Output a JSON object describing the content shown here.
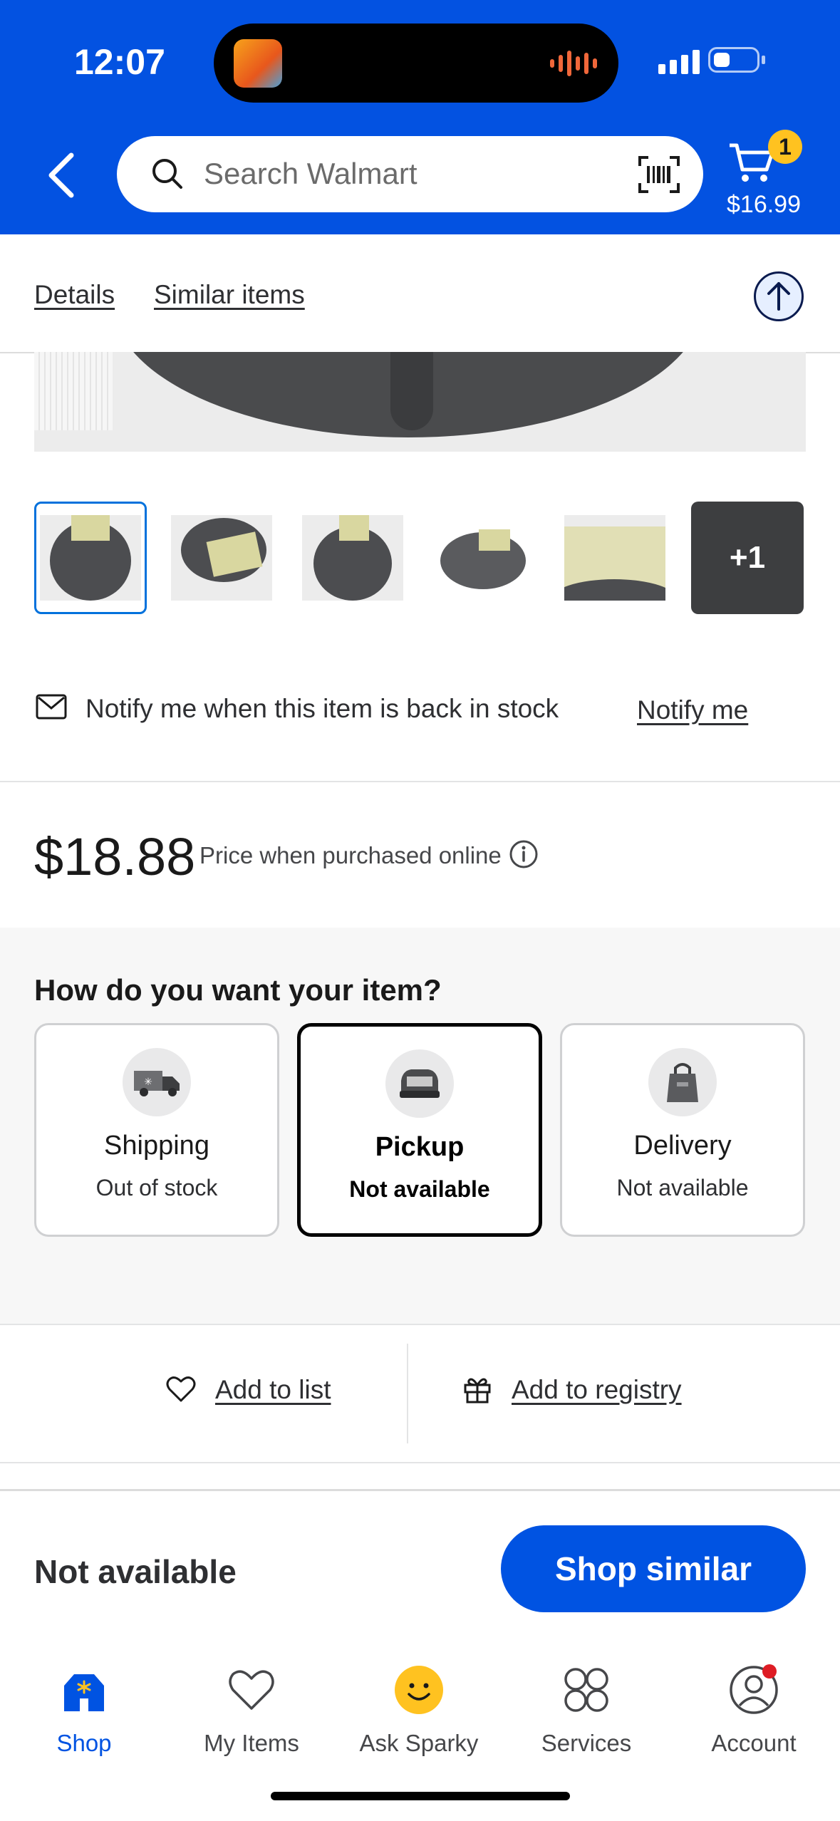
{
  "status_bar": {
    "time": "12:07"
  },
  "header": {
    "search_placeholder": "Search Walmart",
    "cart": {
      "count": "1",
      "total": "$16.99"
    }
  },
  "subnav": {
    "details_label": "Details",
    "similar_label": "Similar items"
  },
  "gallery": {
    "more_label": "+1"
  },
  "notify": {
    "text": "Notify me when this item is back in stock",
    "link": "Notify me"
  },
  "price": {
    "value": "$18.88",
    "note": "Price when purchased online"
  },
  "fulfillment": {
    "heading": "How do you want your item?",
    "options": [
      {
        "title": "Shipping",
        "status": "Out of stock",
        "icon": "truck-icon"
      },
      {
        "title": "Pickup",
        "status": "Not available",
        "icon": "car-icon",
        "selected": true
      },
      {
        "title": "Delivery",
        "status": "Not available",
        "icon": "bag-icon"
      }
    ]
  },
  "actions": {
    "add_to_list": "Add to list",
    "add_to_registry": "Add to registry"
  },
  "sticky": {
    "availability": "Not available",
    "button": "Shop similar"
  },
  "tabbar": {
    "tabs": [
      {
        "label": "Shop",
        "icon": "shop-icon",
        "active": true
      },
      {
        "label": "My Items",
        "icon": "heart-icon"
      },
      {
        "label": "Ask Sparky",
        "icon": "sparky-icon"
      },
      {
        "label": "Services",
        "icon": "services-icon"
      },
      {
        "label": "Account",
        "icon": "account-icon"
      }
    ]
  },
  "colors": {
    "brand_blue": "#0352e1",
    "button_blue": "#0053e2",
    "badge_yellow": "#ffc220",
    "alert_red": "#de1c24"
  }
}
